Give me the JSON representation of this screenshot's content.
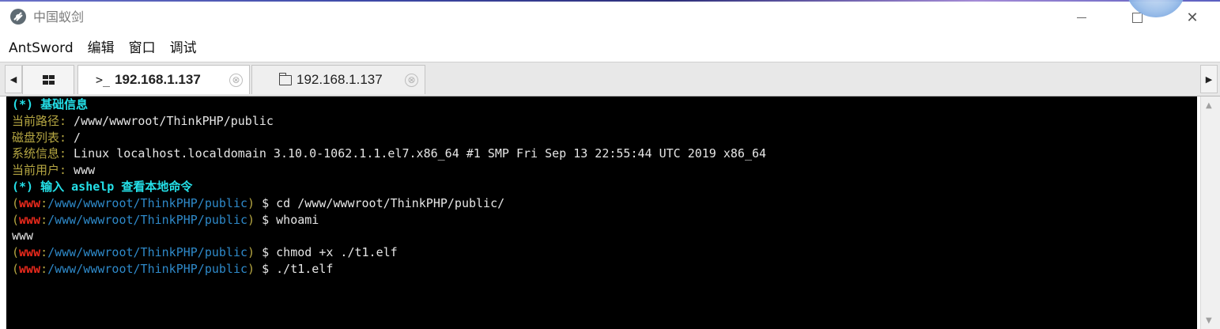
{
  "window": {
    "title": "中国蚁剑",
    "icon": "antsword-logo-icon",
    "controls": {
      "minimize": "minimize-icon",
      "maximize": "maximize-icon",
      "close": "close-icon",
      "close_glyph": "✕"
    }
  },
  "menu": {
    "items": [
      "AntSword",
      "编辑",
      "窗口",
      "调试"
    ]
  },
  "tabs": {
    "grid_icon": "grid-icon",
    "left_arrow": "◀",
    "right_arrow": "▶",
    "items": [
      {
        "icon": "terminal-prompt-icon",
        "icon_glyph": ">_",
        "label": "192.168.1.137",
        "active": true,
        "close": "⊗"
      },
      {
        "icon": "folder-icon",
        "label": "192.168.1.137",
        "active": false,
        "close": "⊗"
      }
    ]
  },
  "terminal": {
    "info_header": "(*) 基础信息",
    "path_label": "当前路径:",
    "path_value": " /www/wwwroot/ThinkPHP/public",
    "disk_label": "磁盘列表:",
    "disk_value": " /",
    "sys_label": "系统信息:",
    "sys_value": " Linux localhost.localdomain 3.10.0-1062.1.1.el7.x86_64 #1 SMP Fri Sep 13 22:55:44 UTC 2019 x86_64",
    "user_label": "当前用户:",
    "user_value": " www",
    "help_line": "(*) 输入 ashelp 查看本地命令",
    "prompt_user": "www",
    "prompt_path": "/www/wwwroot/ThinkPHP/public",
    "commands": [
      {
        "cmd": " $ cd /www/wwwroot/ThinkPHP/public/",
        "output": ""
      },
      {
        "cmd": " $ whoami",
        "output": "www"
      },
      {
        "cmd": " $ chmod +x ./t1.elf",
        "output": ""
      },
      {
        "cmd": " $ ./t1.elf",
        "output": ""
      }
    ]
  },
  "colors": {
    "header_cyan": "#24e0e8",
    "label_olive": "#b5a642",
    "prompt_user_red": "#e8291c",
    "prompt_path_blue": "#2e89c9",
    "terminal_bg": "#000000"
  }
}
